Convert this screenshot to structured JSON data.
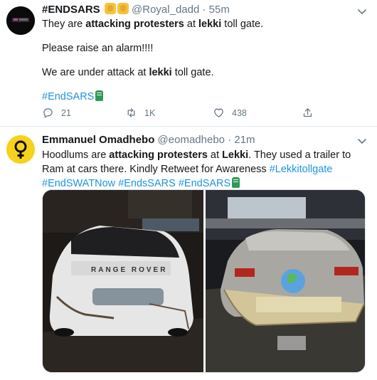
{
  "tweets": [
    {
      "display_name": "#ENDSARS",
      "handle": "@Royal_dadd",
      "separator": "·",
      "time": "55m",
      "lines": {
        "l1_a": "They are ",
        "l1_b": "attacking protesters",
        "l1_c": " at ",
        "l1_d": "lekki",
        "l1_e": " toll gate.",
        "l2": "Please raise an alarm!!!!",
        "l3_a": "We are under attack at ",
        "l3_b": "lekki",
        "l3_c": " toll gate.",
        "hashtag": "#EndSARS"
      },
      "counts": {
        "replies": "21",
        "retweets": "1K",
        "likes": "438"
      }
    },
    {
      "display_name": "Emmanuel Omadhebo",
      "handle": "@eomadhebo",
      "separator": "·",
      "time": "21m",
      "body": {
        "a": "Hoodlums are ",
        "b": "attacking protesters",
        "c": " at ",
        "d": "Lekki",
        "e": ". They used a trailer to Ram at cars there. Kindly Retweet for Awareness ",
        "h1": "#Lekkitollgate",
        "sp1": " ",
        "h2": "#EndSWATNow",
        "br": " ",
        "h3": "#EndsSARS",
        "sp2": " ",
        "h4": "#EndSARS"
      },
      "media_labels": {
        "left_car_badge": "RANGE ROVER"
      }
    }
  ],
  "colors": {
    "link": "#1b95e0",
    "muted": "#657786",
    "divider": "#e6ecf0"
  }
}
